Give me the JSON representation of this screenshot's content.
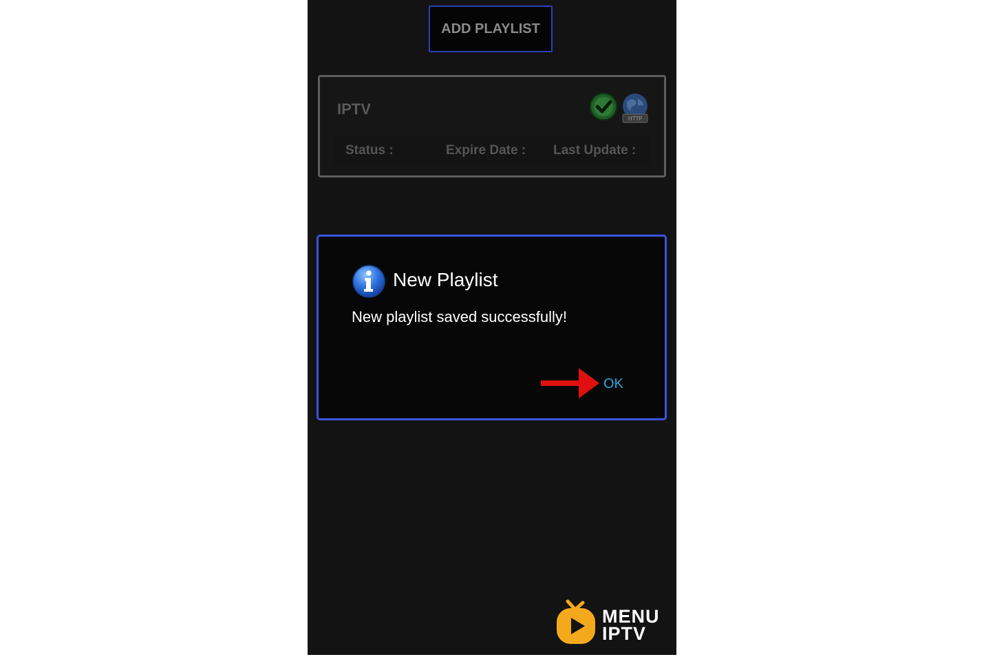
{
  "toolbar": {
    "add_playlist_label": "ADD PLAYLIST"
  },
  "playlist_card": {
    "name": "IPTV",
    "status_label": "Status :",
    "expire_label": "Expire Date :",
    "update_label": "Last Update :",
    "icons": [
      "check-icon",
      "http-globe-icon"
    ],
    "http_badge": "HTTP"
  },
  "dialog": {
    "icon": "info-icon",
    "title": "New Playlist",
    "message": "New playlist saved successfully!",
    "ok_label": "OK"
  },
  "branding": {
    "line1": "MENU",
    "line2": "IPTV"
  },
  "colors": {
    "background": "#131313",
    "dialog_border": "#3a55e0",
    "ok_text": "#2fa8e0",
    "arrow": "#e01010",
    "logo_orange": "#f4a91c"
  }
}
